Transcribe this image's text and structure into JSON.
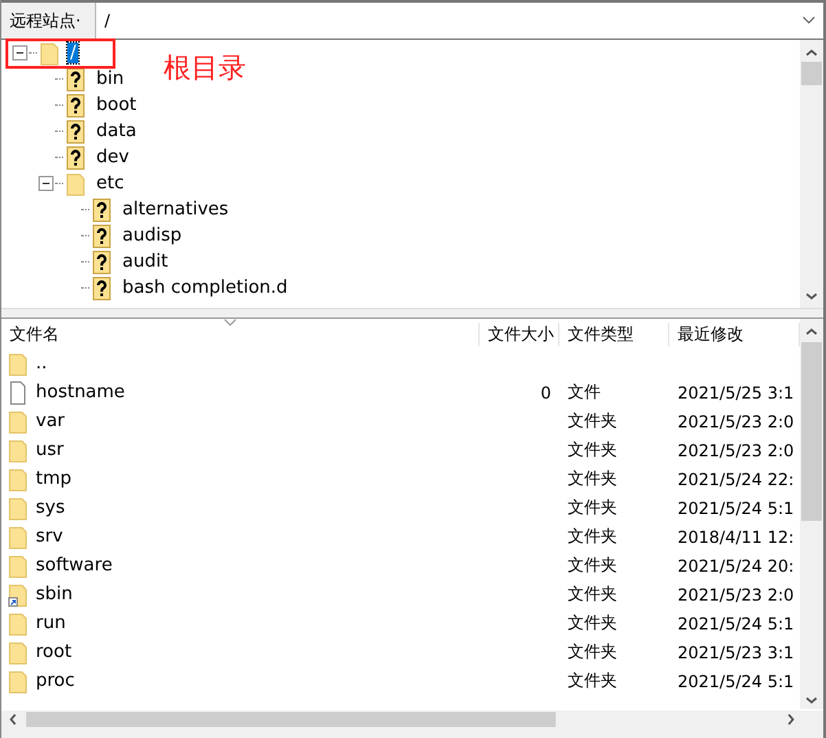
{
  "address_bar": {
    "label": "远程站点·",
    "path": "/"
  },
  "tree": [
    {
      "name": "/",
      "kind": "folder",
      "selected": true,
      "expanded": true,
      "children": [
        {
          "name": "bin",
          "kind": "unknown",
          "selected": false
        },
        {
          "name": "boot",
          "kind": "unknown",
          "selected": false
        },
        {
          "name": "data",
          "kind": "unknown",
          "selected": false
        },
        {
          "name": "dev",
          "kind": "unknown",
          "selected": false
        },
        {
          "name": "etc",
          "kind": "folder",
          "selected": false,
          "expanded": true,
          "children": [
            {
              "name": "alternatives",
              "kind": "unknown",
              "selected": false
            },
            {
              "name": "audisp",
              "kind": "unknown",
              "selected": false
            },
            {
              "name": "audit",
              "kind": "unknown",
              "selected": false
            },
            {
              "name": "bash completion.d",
              "kind": "unknown",
              "selected": false
            }
          ]
        }
      ]
    }
  ],
  "annotation": {
    "label": "根目录"
  },
  "file_list": {
    "columns": [
      "文件名",
      "文件大小",
      "文件类型",
      "最近修改"
    ],
    "rows": [
      {
        "kind": "folder",
        "name": "..",
        "size": "",
        "type": "",
        "modified": ""
      },
      {
        "kind": "file",
        "name": "hostname",
        "size": "0",
        "type": "文件",
        "modified": "2021/5/25 3:1"
      },
      {
        "kind": "folder",
        "name": "var",
        "size": "",
        "type": "文件夹",
        "modified": "2021/5/23 2:0"
      },
      {
        "kind": "folder",
        "name": "usr",
        "size": "",
        "type": "文件夹",
        "modified": "2021/5/23 2:0"
      },
      {
        "kind": "folder",
        "name": "tmp",
        "size": "",
        "type": "文件夹",
        "modified": "2021/5/24 22:"
      },
      {
        "kind": "folder",
        "name": "sys",
        "size": "",
        "type": "文件夹",
        "modified": "2021/5/24 5:1"
      },
      {
        "kind": "folder",
        "name": "srv",
        "size": "",
        "type": "文件夹",
        "modified": "2018/4/11 12:"
      },
      {
        "kind": "folder",
        "name": "software",
        "size": "",
        "type": "文件夹",
        "modified": "2021/5/24 20:"
      },
      {
        "kind": "link",
        "name": "sbin",
        "size": "",
        "type": "文件夹",
        "modified": "2021/5/23 2:0"
      },
      {
        "kind": "folder",
        "name": "run",
        "size": "",
        "type": "文件夹",
        "modified": "2021/5/24 5:1"
      },
      {
        "kind": "folder",
        "name": "root",
        "size": "",
        "type": "文件夹",
        "modified": "2021/5/23 3:1"
      },
      {
        "kind": "folder",
        "name": "proc",
        "size": "",
        "type": "文件夹",
        "modified": "2021/5/24 5:1"
      }
    ]
  }
}
